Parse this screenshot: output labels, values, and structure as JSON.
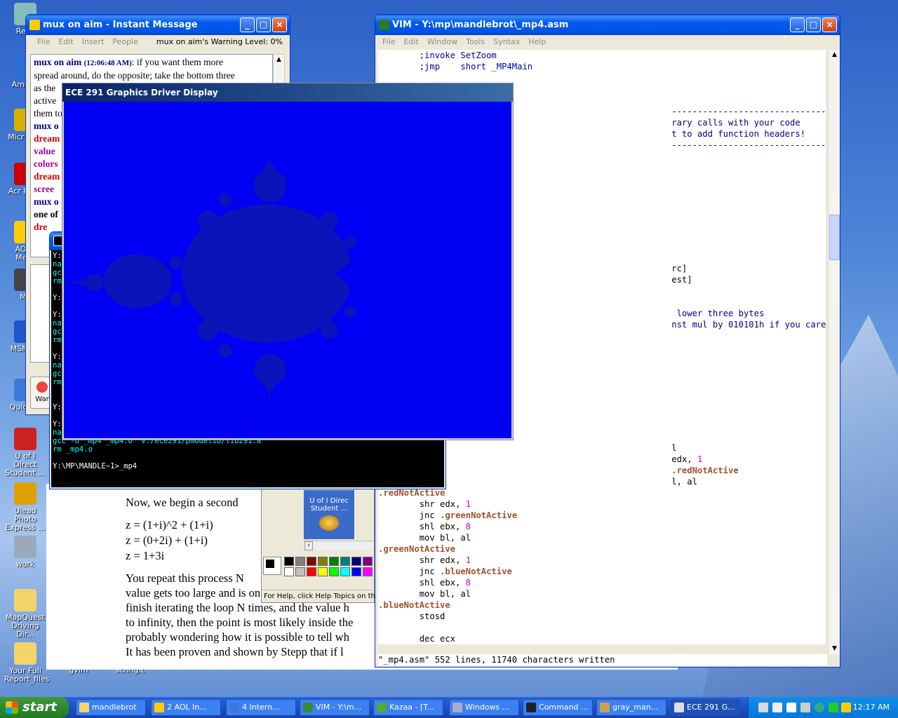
{
  "desktop": {
    "icons": [
      {
        "label": "Recy",
        "color": "#8bb"
      },
      {
        "label": "Americ",
        "color": "#2a6fd6"
      },
      {
        "label": "Micr Outl",
        "color": "#d9b200"
      },
      {
        "label": "Acr Reac",
        "color": "#c00"
      },
      {
        "label": "AOL I Mess",
        "color": "#ffcc00"
      },
      {
        "label": "Mc",
        "color": "#444"
      },
      {
        "label": "MSN Zo",
        "color": "#1e55c8"
      },
      {
        "label": "Quic Pla",
        "color": "#3d7ad8"
      },
      {
        "label": "U of I Direct Student ...",
        "color": "#c22"
      },
      {
        "label": "Ulead Photo Express ...",
        "color": "#e0a000"
      },
      {
        "label": "work",
        "color": "#9ab"
      },
      {
        "label": "MapQuest Driving Dir...",
        "color": "#f4d46a"
      },
      {
        "label": "Your Full Report_files",
        "color": "#f4d46a"
      }
    ],
    "bottom_labels": [
      "gvim",
      "schng.c"
    ]
  },
  "aim": {
    "title": "mux on aim - Instant Message",
    "menu": [
      "File",
      "Edit",
      "Insert",
      "People"
    ],
    "warning": "mux on aim's Warning Level: 0%",
    "messages": [
      {
        "sender": "mux on aim",
        "time": "(12:06:48 AM)",
        "text": ": if you want them more"
      },
      {
        "text": "spread around, do the opposite; take the bottom three"
      },
      {
        "text": "as the"
      },
      {
        "text": "active"
      },
      {
        "text": "them to"
      },
      {
        "text": "mux o"
      },
      {
        "text": "dream"
      },
      {
        "text": "value"
      },
      {
        "text": "colors"
      },
      {
        "text": "dream"
      },
      {
        "text": "scree"
      },
      {
        "text": "mux o"
      },
      {
        "text": "one of"
      },
      {
        "text": "dre"
      }
    ],
    "warn_btn": "War"
  },
  "vim": {
    "title": "VIM - Y:\\mp\\mandlebrot\\_mp4.asm",
    "menu": [
      "File",
      "Edit",
      "Window",
      "Tools",
      "Syntax",
      "Help"
    ],
    "status": "\"_mp4.asm\" 552 lines, 11740 characters written"
  },
  "gfx": {
    "title": "ECE 291 Graphics Driver Display",
    "background": "#0000f5",
    "set_color": "#0a14b8"
  },
  "cmd": {
    "lines": [
      "Y:",
      "na",
      "gc",
      "rm",
      "",
      "Y:",
      "",
      "Y:",
      "na",
      "gc",
      "rm",
      "",
      "Y:",
      "na",
      "gc",
      "rm",
      "",
      "",
      "Y:",
      "",
      "Y:",
      "nasm -f coff -Iv:/ece291/pmodelib/include/ -o _mp4.o _mp4.asm -l _mp4.lst",
      "gcc -o _mp4 _mp4.o  v:/ece291/pmodelib/lib291.a",
      "rm _mp4.o",
      "",
      "Y:\\MP\\MANDLE~1>_mp4"
    ]
  },
  "doc": {
    "p1": "Now, we begin a second",
    "eq1": "z = (1+i)^2 + (1+i)",
    "eq2": "z = (0+2i) + (1+i)",
    "eq3": "z = 1+3i",
    "p2_lines": [
      "You repeat this process N",
      "value gets too large and is on course to reach in",
      "finish iterating the loop N times, and the value h",
      "to infinity, then the point is most likely inside the",
      "probably wondering how it is possible to tell wh",
      "It has been proven and shown by Stepp that if l"
    ]
  },
  "paint": {
    "help": "For Help, click Help Topics on the",
    "thumb_label": "U of I Direc Student ...",
    "palette": [
      "#000000",
      "#808080",
      "#800000",
      "#808000",
      "#008000",
      "#008080",
      "#000080",
      "#800080",
      "#ffffff",
      "#c0c0c0",
      "#ff0000",
      "#ffff00",
      "#00ff00",
      "#00ffff",
      "#0000ff",
      "#ff00ff"
    ]
  },
  "taskbar": {
    "start": "start",
    "items": [
      {
        "label": "mandlebrot",
        "color": "#f4d46a"
      },
      {
        "label": "2 AOL In...",
        "color": "#ffcc00"
      },
      {
        "label": "4 Intern...",
        "color": "#3d7ad8"
      },
      {
        "label": "VIM - Y:\\m...",
        "color": "#3a8a3a"
      },
      {
        "label": "Kazaa - [T...",
        "color": "#55aa33"
      },
      {
        "label": "Windows ...",
        "color": "#aac"
      },
      {
        "label": "Command ...",
        "color": "#222"
      },
      {
        "label": "gray_man...",
        "color": "#c8a050"
      },
      {
        "label": "ECE 291 G...",
        "color": "#ddd"
      }
    ],
    "clock": "12:17 AM"
  }
}
